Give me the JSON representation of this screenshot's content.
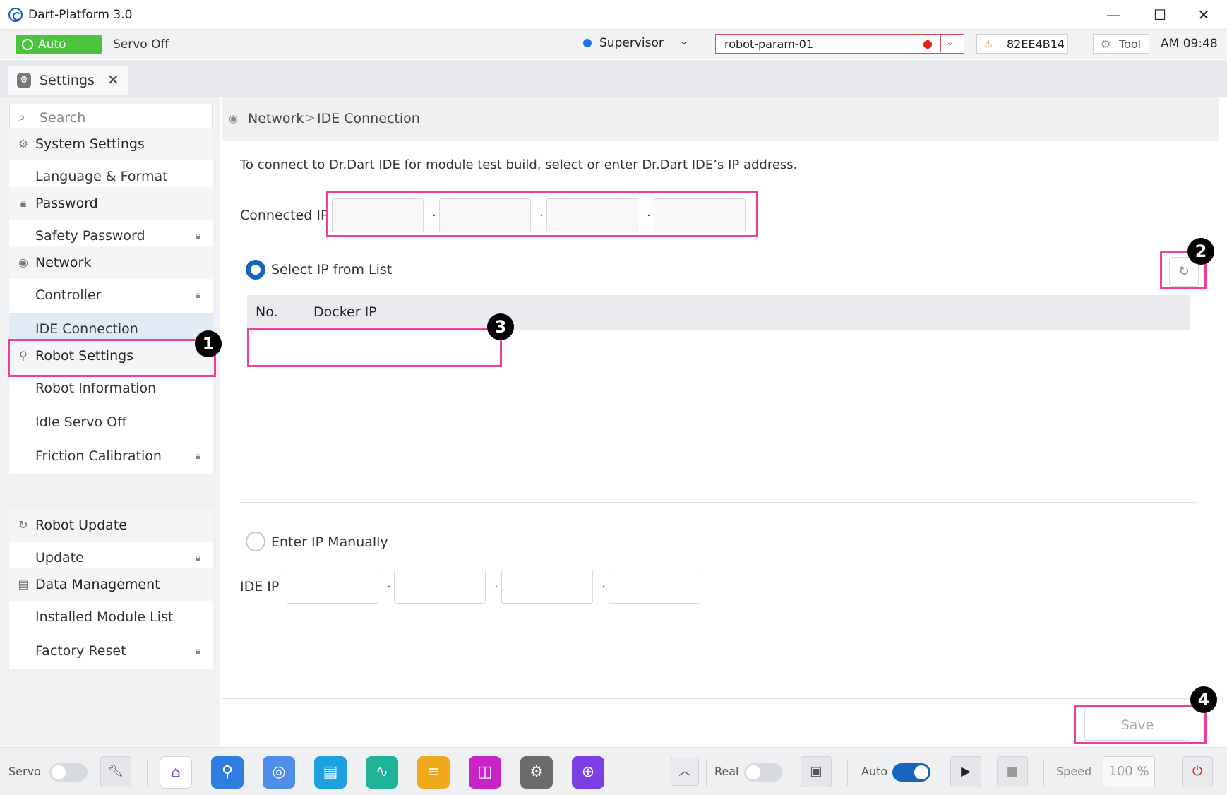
{
  "window": {
    "title": "Dart-Platform 3.0",
    "minimize": "—",
    "maximize": "☐",
    "close": "✕"
  },
  "status": {
    "mode": "Auto",
    "servo": "Servo Off",
    "user_role": "Supervisor",
    "param_file": "robot-param-01",
    "robot_id": "82EE4B14",
    "tool_label": "Tool",
    "time": "AM 09:48",
    "colors": {
      "auto": "#4cc33c",
      "alert": "#d9261c",
      "accent": "#1565c0"
    }
  },
  "tabs": [
    {
      "label": "Settings",
      "icon": "gear-icon",
      "close": "✕"
    }
  ],
  "sidebar": {
    "search_placeholder": "Search",
    "groups": [
      {
        "title": "System Settings",
        "icon": "gear-icon",
        "items": [
          {
            "label": "Language & Format",
            "locked": false
          }
        ]
      },
      {
        "title": "Password",
        "icon": "lock-icon",
        "items": [
          {
            "label": "Safety Password",
            "locked": true
          }
        ]
      },
      {
        "title": "Network",
        "icon": "network-icon",
        "items": [
          {
            "label": "Controller",
            "locked": true
          },
          {
            "label": "IDE Connection",
            "locked": false,
            "active": true
          }
        ]
      },
      {
        "title": "Robot Settings",
        "icon": "robot-arm-icon",
        "items": [
          {
            "label": "Robot Information",
            "locked": false
          },
          {
            "label": "Idle Servo Off",
            "locked": false
          },
          {
            "label": "Friction Calibration",
            "locked": true
          }
        ]
      },
      {
        "title": "Robot Update",
        "icon": "refresh-icon",
        "items": [
          {
            "label": "Update",
            "locked": true
          }
        ]
      },
      {
        "title": "Data Management",
        "icon": "document-icon",
        "items": [
          {
            "label": "Installed Module List",
            "locked": false
          },
          {
            "label": "Factory Reset",
            "locked": true
          }
        ]
      }
    ]
  },
  "breadcrumb": {
    "parent": "Network",
    "separator": ">",
    "current": "IDE Connection"
  },
  "content": {
    "description": "To connect to Dr.Dart IDE for module test build, select or enter Dr.Dart IDE’s IP address.",
    "connected_ip_label": "Connected IP",
    "connected_ip": [
      "",
      "",
      "",
      ""
    ],
    "ip_separator": "·",
    "select_option": "Select IP from List",
    "table": {
      "headers": [
        "No.",
        "Docker IP"
      ],
      "rows": []
    },
    "manual_option": "Enter IP Manually",
    "ide_ip_label": "IDE IP",
    "ide_ip": [
      "",
      "",
      "",
      ""
    ],
    "save_label": "Save"
  },
  "markers": [
    "1",
    "2",
    "3",
    "4"
  ],
  "bottom": {
    "servo_label": "Servo",
    "real_label": "Real",
    "auto_label": "Auto",
    "speed_label": "Speed",
    "speed_value": "100 %",
    "apps": [
      {
        "name": "home-app-icon",
        "color": "#ffffff"
      },
      {
        "name": "robot-app-icon",
        "color": "#2f7de1"
      },
      {
        "name": "remote-app-icon",
        "color": "#4e8ee8"
      },
      {
        "name": "task-app-icon",
        "color": "#1e9fe0"
      },
      {
        "name": "monitor-app-icon",
        "color": "#1fb39a"
      },
      {
        "name": "log-app-icon",
        "color": "#f0a81a"
      },
      {
        "name": "store-app-icon",
        "color": "#c823c8"
      },
      {
        "name": "settings-app-icon",
        "color": "#6b6b6b"
      },
      {
        "name": "jog-app-icon",
        "color": "#7b3fe4"
      }
    ]
  }
}
